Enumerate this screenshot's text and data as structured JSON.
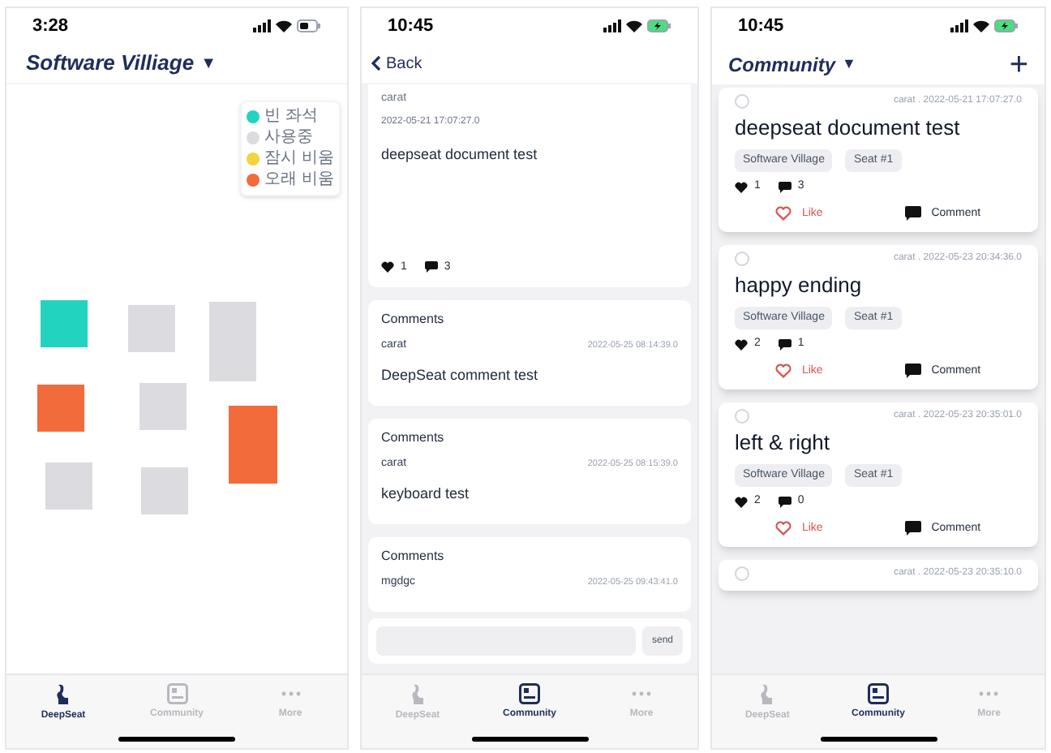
{
  "screens": [
    {
      "kind": "map",
      "status_bar": {
        "time": "3:28",
        "charging": false
      },
      "header": {
        "title": "Software Villiage",
        "caret": "▼"
      },
      "legend": [
        {
          "label": "빈 좌석",
          "color": "#22d3c0"
        },
        {
          "label": "사용중",
          "color": "#dcdce0"
        },
        {
          "label": "잠시 비움",
          "color": "#f5d33a"
        },
        {
          "label": "오래 비움",
          "color": "#f26b3a"
        }
      ],
      "seats": [
        {
          "color": "#22d3c0"
        },
        {
          "color": "#dcdce0"
        },
        {
          "color": "#dcdce0"
        },
        {
          "color": "#f26b3a"
        },
        {
          "color": "#dcdce0"
        },
        {
          "color": "#f26b3a"
        },
        {
          "color": "#dcdce0"
        },
        {
          "color": "#dcdce0"
        }
      ],
      "tab_bar": [
        {
          "kind": "seat",
          "label": "DeepSeat",
          "selected": true
        },
        {
          "kind": "board",
          "label": "Community",
          "selected": false
        },
        {
          "kind": "more",
          "label": "More",
          "selected": false
        }
      ]
    },
    {
      "kind": "detail",
      "status_bar": {
        "time": "10:45",
        "charging": true
      },
      "header": {
        "back": "Back"
      },
      "post": {
        "author": "carat",
        "date": "2022-05-21 17:07:27.0",
        "text": "deepseat document test",
        "likes": "1",
        "comments": "3"
      },
      "comments": [
        {
          "heading": "Comments",
          "author": "carat",
          "date": "2022-05-25 08:14:39.0",
          "text": "DeepSeat comment test"
        },
        {
          "heading": "Comments",
          "author": "carat",
          "date": "2022-05-25 08:15:39.0",
          "text": "keyboard test"
        },
        {
          "heading": "Comments",
          "author": "mgdgc",
          "date": "2022-05-25 09:43:41.0"
        }
      ],
      "send_button": "send",
      "tab_bar": [
        {
          "kind": "seat",
          "label": "DeepSeat",
          "selected": false
        },
        {
          "kind": "board",
          "label": "Community",
          "selected": true
        },
        {
          "kind": "more",
          "label": "More",
          "selected": false
        }
      ]
    },
    {
      "kind": "community",
      "status_bar": {
        "time": "10:45",
        "charging": true
      },
      "header": {
        "title": "Community",
        "caret": "▼",
        "add": "+"
      },
      "posts": [
        {
          "meta": "carat . 2022-05-21 17:07:27.0",
          "title": "deepseat document test",
          "tags": [
            "Software Village",
            "Seat #1"
          ],
          "likes": "1",
          "comments": "3",
          "like_button": "Like",
          "comment_button": "Comment"
        },
        {
          "meta": "carat . 2022-05-23 20:34:36.0",
          "title": "happy ending",
          "tags": [
            "Software Village",
            "Seat #1"
          ],
          "likes": "2",
          "comments": "1",
          "like_button": "Like",
          "comment_button": "Comment"
        },
        {
          "meta": "carat . 2022-05-23 20:35:01.0",
          "title": "left & right",
          "tags": [
            "Software Village",
            "Seat #1"
          ],
          "likes": "2",
          "comments": "0",
          "like_button": "Like",
          "comment_button": "Comment"
        },
        {
          "meta": "carat . 2022-05-23 20:35:10.0"
        }
      ],
      "tab_bar": [
        {
          "kind": "seat",
          "label": "DeepSeat",
          "selected": false
        },
        {
          "kind": "board",
          "label": "Community",
          "selected": true
        },
        {
          "kind": "more",
          "label": "More",
          "selected": false
        }
      ]
    }
  ]
}
